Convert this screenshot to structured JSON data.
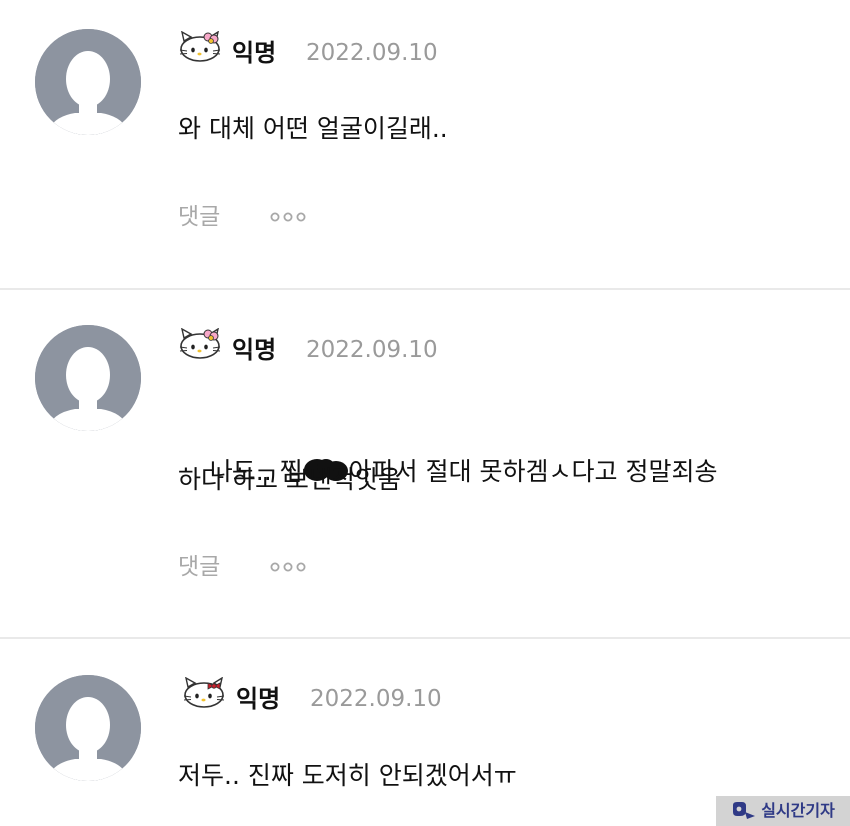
{
  "comments": [
    {
      "author": "익명",
      "date": "2022.09.10",
      "text": "와 대체 어떤 얼굴이길래..",
      "reply_label": "댓글",
      "bow_color": "#f7a8c8"
    },
    {
      "author": "익명",
      "date": "2022.09.10",
      "text_before": "나도.. 찜",
      "text_after": "아파서 절대 못하겜ㅅ다고 정말죄송",
      "text_line2": "하다 하고 보낸적잇음",
      "reply_label": "댓글",
      "bow_color": "#f7a8c8"
    },
    {
      "author": "익명",
      "date": "2022.09.10",
      "text": "저두.. 진짜 도저히 안되겠어서ㅠ",
      "bow_color": "#c8202c"
    }
  ],
  "watermark": {
    "text": "실시간기자",
    "color": "#2f3a86"
  },
  "icons": {
    "avatar": "default-profile-icon",
    "author_badge": "hello-kitty-icon",
    "more": "more-dots-icon",
    "censor": "censor-blot"
  },
  "colors": {
    "avatar_bg": "#8d94a0",
    "meta_gray": "#9a9a9a",
    "divider": "#e9e9e9"
  }
}
